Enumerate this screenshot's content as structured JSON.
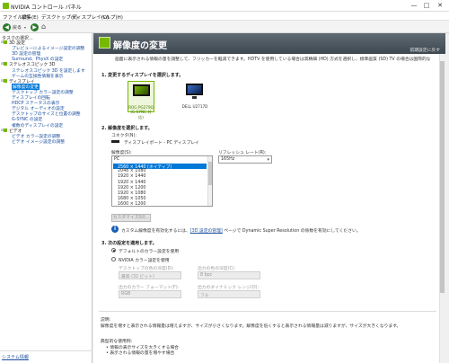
{
  "window": {
    "title": "NVIDIA コントロール パネル",
    "minimize": "—",
    "maximize": "□",
    "close": "✕"
  },
  "menu": [
    "ファイル(F)",
    "編集(E)",
    "デスクトップ(K)",
    "ディスプレイ(D)",
    "ヘルプ(H)"
  ],
  "toolbar": {
    "back": "戻る"
  },
  "tree": {
    "header": "タスクの選択...",
    "items": [
      {
        "label": "3D 設定",
        "level": 0
      },
      {
        "label": "プレビューによるイメージ設定の調整",
        "level": 1
      },
      {
        "label": "3D 設定の管理",
        "level": 1
      },
      {
        "label": "Surround、PhysX の設定",
        "level": 1
      },
      {
        "label": "ステレオスコピック 3D",
        "level": 0
      },
      {
        "label": "ステレオスコピック 3D を設定します",
        "level": 1
      },
      {
        "label": "ゲームの互換性情報を表示",
        "level": 1
      },
      {
        "label": "ディスプレイ",
        "level": 0
      },
      {
        "label": "解像度の変更",
        "level": 1,
        "selected": true
      },
      {
        "label": "デスクトップ カラー設定の調整",
        "level": 1
      },
      {
        "label": "ディスプレイの回転",
        "level": 1
      },
      {
        "label": "HDCP ステータスの表示",
        "level": 1
      },
      {
        "label": "デジタル オーディオの設定",
        "level": 1
      },
      {
        "label": "デスクトップのサイズと位置の調整",
        "level": 1
      },
      {
        "label": "G-SYNC の設定",
        "level": 1
      },
      {
        "label": "複数のディスプレイの設定",
        "level": 1
      },
      {
        "label": "ビデオ",
        "level": 0
      },
      {
        "label": "ビデオ カラー設定の調整",
        "level": 1
      },
      {
        "label": "ビデオ イメージ設定の調整",
        "level": 1
      }
    ],
    "sysinfo": "システム情報"
  },
  "page": {
    "title": "解像度の変更",
    "restore": "前期設定に戻す",
    "description": "画面に表示される情報の量を調整して、フリッカーを軽減できます。HDTV を使用している場合は高精細 (HD) 方式を選択し、標準画質 (SD) TV の場合は国際的な信号を設定することができます。",
    "section1": "1. 変更するディスプレイを選択します。",
    "displays": [
      {
        "name": "ROG PG279Q",
        "sub": "(G-SYNC 対応)",
        "selected": true
      },
      {
        "name": "DELL U2717D",
        "sub": "",
        "selected": false
      }
    ],
    "section2": "2. 解像度を選択します。",
    "connector_label": "コネクタ(N):",
    "connector_value": "ディスプレイポート - PC ディスプレイ",
    "resolution_label": "解像度(S):",
    "refresh_label": "リフレッシュ レート(R):",
    "refresh_value": "165Hz",
    "res_group": "PC",
    "resolutions": [
      {
        "label": "2560 × 1440 (ネイティブ)",
        "selected": true
      },
      {
        "label": "2048 × 1080",
        "selected": false
      },
      {
        "label": "1920 × 1440",
        "selected": false
      },
      {
        "label": "1920 × 1440",
        "selected": false
      },
      {
        "label": "1920 × 1200",
        "selected": false
      },
      {
        "label": "1920 × 1080",
        "selected": false
      },
      {
        "label": "1680 × 1050",
        "selected": false
      },
      {
        "label": "1600 × 1200",
        "selected": false
      }
    ],
    "customize_button": "カスタマイズ(U)...",
    "info_prefix": "カスタム解像度を有効化するには、",
    "info_link": "[3D 設定の管理]",
    "info_suffix": " ページで Dynamic Super Resolution の係数を有効にしてください。",
    "section3": "3. 次の設定を適用します。",
    "radio_default": "デフォルトのカラー設定を使用",
    "radio_nvidia": "NVIDIA カラー設定を使用",
    "field_depth_label": "デスクトップの色の深度(D):",
    "field_depth_value": "最高 (32 ビット)",
    "field_bpc_label": "出力の色の深度(C):",
    "field_bpc_value": "8 bpc",
    "field_format_label": "出力のカラー フォーマット(F):",
    "field_format_value": "RGB",
    "field_range_label": "出力のダイナミック レンジ(O):",
    "field_range_value": "フル",
    "explain_heading": "説明:",
    "explain_text": "解像度を増すと表示される情報量は増えますが、サイズが小さくなります。解像度を低くすると表示される情報量は減りますが、サイズが大きくなります。",
    "usage_heading": "典型的な使用例:",
    "usage_1": "• 情報の表示サイズを大きくする場合",
    "usage_2": "• 表示される情報の量を増やす場合"
  },
  "colors": {
    "nvidia_green": "#76b900",
    "banner": "#4a545c",
    "selection": "#0078d7"
  }
}
